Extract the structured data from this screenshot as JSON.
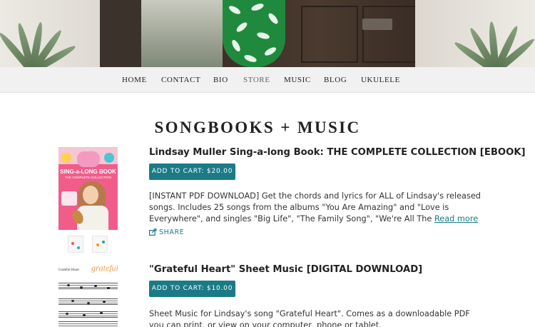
{
  "nav": {
    "items": [
      "HOME",
      "CONTACT",
      "BIO",
      "STORE",
      "MUSIC",
      "BLOG",
      "UKULELE"
    ],
    "active": "STORE"
  },
  "page": {
    "title": "SONGBOOKS + MUSIC"
  },
  "products": [
    {
      "title": "Lindsay Muller Sing-a-long Book: THE COMPLETE COLLECTION [EBOOK]",
      "cart_label": "ADD TO CART: $20.00",
      "description": "[INSTANT PDF DOWNLOAD] Get the chords and lyrics for ALL of Lindsay's released songs. Includes 25 songs from the albums \"You Are Amazing\" and \"Love is Everywhere\", and singles \"Big Life\", \"The Family Song\", \"We're All The ",
      "read_more": "Read more",
      "share_label": "SHARE",
      "cover": {
        "title_line1": "SING-a-LONG BOOK",
        "subtitle": "THE COMPLETE COLLECTION"
      }
    },
    {
      "title": "\"Grateful Heart\" Sheet Music [DIGITAL DOWNLOAD]",
      "cart_label": "ADD TO CART: $10.00",
      "description": "Sheet Music for Lindsay's song \"Grateful Heart\". Comes as a downloadable PDF you can print, or view on your computer, phone or tablet.",
      "sheet": {
        "heading": "Grateful Heart",
        "script": "grateful"
      }
    }
  ],
  "colors": {
    "accent": "#1a7b87",
    "nav_bg": "#f1f1f1",
    "cover_pink": "#f15c8a"
  },
  "icons": {
    "share": "share-icon"
  }
}
